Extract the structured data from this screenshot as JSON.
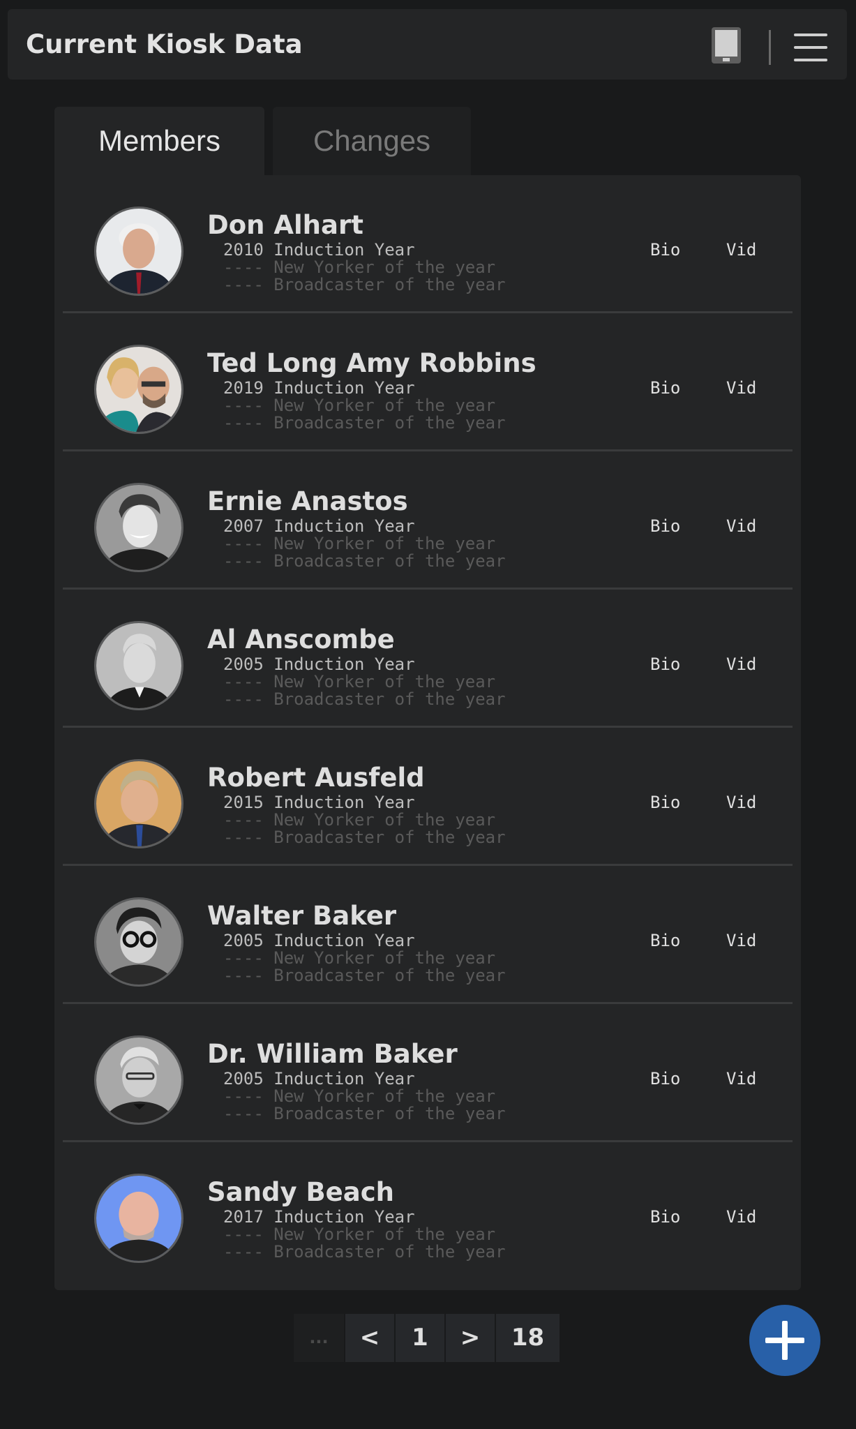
{
  "header": {
    "title": "Current Kiosk Data"
  },
  "tabs": [
    {
      "label": "Members",
      "active": true
    },
    {
      "label": "Changes",
      "active": false
    }
  ],
  "members": [
    {
      "name": "Don Alhart",
      "year": "2010 Induction Year",
      "award1": "---- New Yorker of the year",
      "award2": "---- Broadcaster of the year",
      "bio": "Bio",
      "vid": "Vid"
    },
    {
      "name": "Ted Long Amy Robbins",
      "year": "2019 Induction Year",
      "award1": "---- New Yorker of the year",
      "award2": "---- Broadcaster of the year",
      "bio": "Bio",
      "vid": "Vid"
    },
    {
      "name": "Ernie Anastos",
      "year": "2007 Induction Year",
      "award1": "---- New Yorker of the year",
      "award2": "---- Broadcaster of the year",
      "bio": "Bio",
      "vid": "Vid"
    },
    {
      "name": "Al Anscombe",
      "year": "2005 Induction Year",
      "award1": "---- New Yorker of the year",
      "award2": "---- Broadcaster of the year",
      "bio": "Bio",
      "vid": "Vid"
    },
    {
      "name": "Robert Ausfeld",
      "year": "2015 Induction Year",
      "award1": "---- New Yorker of the year",
      "award2": "---- Broadcaster of the year",
      "bio": "Bio",
      "vid": "Vid"
    },
    {
      "name": "Walter Baker",
      "year": "2005 Induction Year",
      "award1": "---- New Yorker of the year",
      "award2": "---- Broadcaster of the year",
      "bio": "Bio",
      "vid": "Vid"
    },
    {
      "name": "Dr. William Baker",
      "year": "2005 Induction Year",
      "award1": "---- New Yorker of the year",
      "award2": "---- Broadcaster of the year",
      "bio": "Bio",
      "vid": "Vid"
    },
    {
      "name": "Sandy Beach",
      "year": "2017 Induction Year",
      "award1": "---- New Yorker of the year",
      "award2": "---- Broadcaster of the year",
      "bio": "Bio",
      "vid": "Vid"
    }
  ],
  "pagination": {
    "ellipsis": "...",
    "prev": "<",
    "current": "1",
    "next": ">",
    "last": "18"
  },
  "icons": {
    "header_left": "tablet-icon",
    "header_right": "hamburger-menu-icon",
    "fab": "plus-icon"
  },
  "colors": {
    "accent": "#2860a8"
  }
}
